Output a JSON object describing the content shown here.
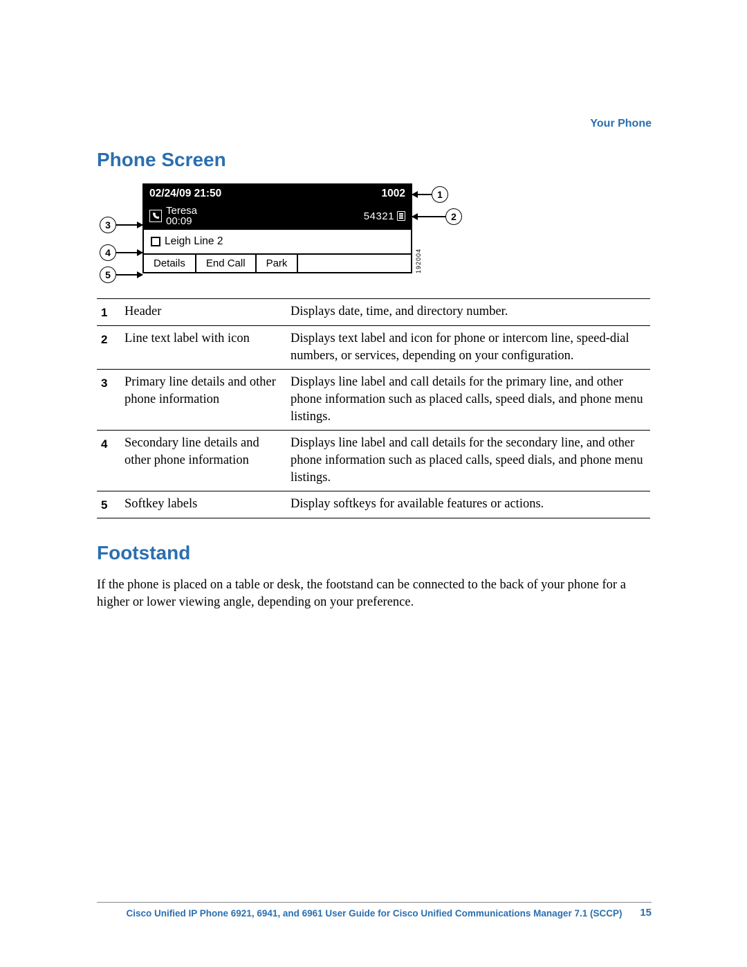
{
  "breadcrumb": "Your Phone",
  "sections": {
    "phone_screen_title": "Phone Screen",
    "footstand_title": "Footstand",
    "footstand_body": "If the phone is placed on a table or desk, the footstand can be connected to the back of your phone for a higher or lower viewing angle, depending on your preference."
  },
  "phone_display": {
    "header_datetime": "02/24/09 21:50",
    "header_dn": "1002",
    "primary_name": "Teresa",
    "primary_timer": "00:09",
    "primary_ext": "54321",
    "secondary_label": "Leigh  Line 2",
    "softkeys": [
      "Details",
      "End Call",
      "Park"
    ],
    "figure_number": "192004"
  },
  "callouts": {
    "c1": "1",
    "c2": "2",
    "c3": "3",
    "c4": "4",
    "c5": "5"
  },
  "legend": [
    {
      "n": "1",
      "name": "Header",
      "desc": "Displays date, time, and directory number."
    },
    {
      "n": "2",
      "name": "Line text label with icon",
      "desc": "Displays text label and icon for phone or intercom line, speed-dial numbers, or services, depending on your configuration."
    },
    {
      "n": "3",
      "name": "Primary line details and other phone information",
      "desc": "Displays line label and call details for the primary line, and other phone information such as placed calls, speed dials, and phone menu listings."
    },
    {
      "n": "4",
      "name": "Secondary line details and other phone information",
      "desc": "Displays line label and call details for the secondary line, and other phone information such as placed calls, speed dials, and phone menu listings."
    },
    {
      "n": "5",
      "name": "Softkey labels",
      "desc": "Display softkeys for available features or actions."
    }
  ],
  "footer": {
    "title": "Cisco Unified IP Phone 6921, 6941, and 6961 User Guide for Cisco Unified Communications Manager 7.1 (SCCP)",
    "page": "15"
  }
}
